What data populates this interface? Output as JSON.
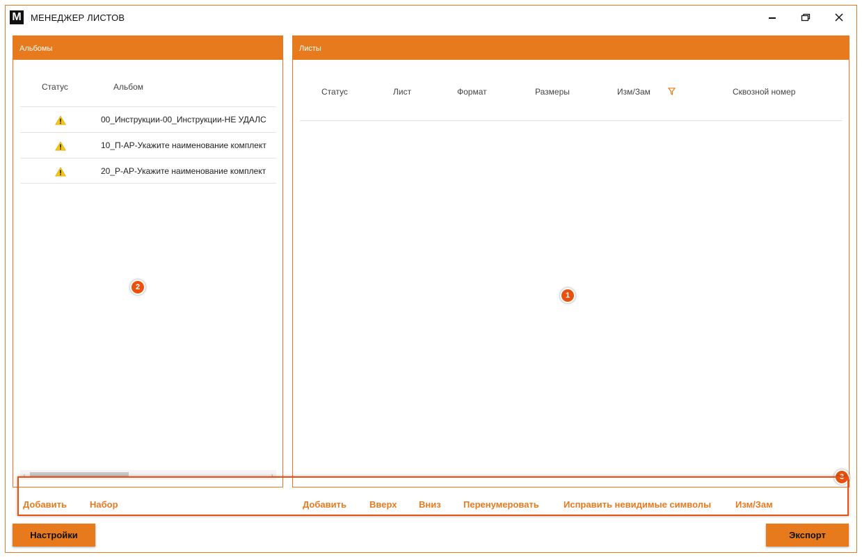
{
  "window": {
    "logo_letter": "M",
    "title": "МЕНЕДЖЕР ЛИСТОВ",
    "minimize_glyph": "—",
    "maximize_glyph": "▭",
    "close_glyph": "✕"
  },
  "albums_panel": {
    "header": "Альбомы",
    "columns": {
      "status": "Статус",
      "album": "Альбом"
    },
    "rows": [
      {
        "status_icon": "warning-icon",
        "name": "00_Инструкции-00_Инструкции-НЕ УДАЛС"
      },
      {
        "status_icon": "warning-icon",
        "name": "10_П-АР-Укажите наименование комплект"
      },
      {
        "status_icon": "warning-icon",
        "name": "20_Р-АР-Укажите наименование комплект"
      }
    ],
    "scroll_left": "‹",
    "scroll_right": "›"
  },
  "sheets_panel": {
    "header": "Листы",
    "columns": {
      "status": "Статус",
      "sheet": "Лист",
      "format": "Формат",
      "sizes": "Размеры",
      "rev": "Изм/Зам",
      "through_number": "Сквозной номер"
    },
    "filter_icon": "filter-icon"
  },
  "markers": {
    "one": "1",
    "two": "2",
    "three": "3"
  },
  "album_actions": {
    "add": "Добавить",
    "set": "Набор"
  },
  "sheet_actions": {
    "add": "Добавить",
    "up": "Вверх",
    "down": "Вниз",
    "renumber": "Перенумеровать",
    "fix_invisible": "Исправить невидимые символы",
    "rev": "Изм/Зам"
  },
  "footer": {
    "settings": "Настройки",
    "export": "Экспорт"
  },
  "colors": {
    "accent": "#e87a1e",
    "marker": "#e8520e",
    "warning": "#f5c518"
  }
}
